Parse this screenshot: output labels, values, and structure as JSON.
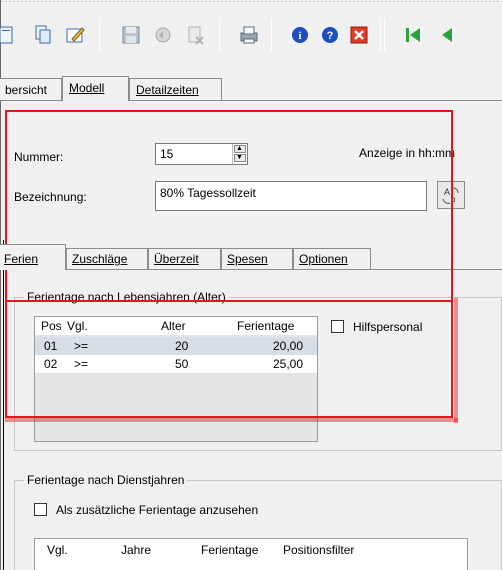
{
  "tabs": [
    {
      "label": "bersicht"
    },
    {
      "label": "Modell"
    },
    {
      "label": "Detailzeiten"
    }
  ],
  "form": {
    "nummer_label": "Nummer:",
    "nummer_value": "15",
    "anzeige_label": "Anzeige in hh:mm",
    "bezeichnung_label": "Bezeichnung:",
    "bezeichnung_value": "80% Tagessollzeit"
  },
  "inner_tabs": [
    {
      "label": "Ferien"
    },
    {
      "label": "Zuschläge"
    },
    {
      "label": "Überzeit"
    },
    {
      "label": "Spesen"
    },
    {
      "label": "Optionen"
    }
  ],
  "group1": {
    "title": "Ferientage nach Lebensjahren (Alter)",
    "columns": [
      "Pos",
      "Vgl.",
      "Alter",
      "Ferientage"
    ],
    "rows": [
      {
        "pos": "01",
        "vgl": ">=",
        "alter": "20",
        "ferientage": "20,00"
      },
      {
        "pos": "02",
        "vgl": ">=",
        "alter": "50",
        "ferientage": "25,00"
      }
    ],
    "checkbox_label": "Hilfspersonal"
  },
  "group2": {
    "title": "Ferientage nach Dienstjahren",
    "checkbox_label": "Als zusätzliche Ferientage anzusehen",
    "columns": [
      "Vgl.",
      "Jahre",
      "Ferientage",
      "Positionsfilter"
    ]
  },
  "colors": {
    "annotation_red": "#e8141a",
    "selected_row": "#d6dde6"
  }
}
